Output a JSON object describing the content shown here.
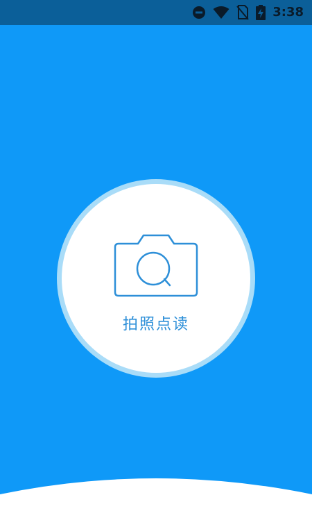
{
  "status_bar": {
    "time": "3:38",
    "icons": [
      "do-not-disturb-icon",
      "wifi-icon",
      "no-sim-icon",
      "battery-charging-icon"
    ]
  },
  "main": {
    "button_label": "拍照点读",
    "button_icon": "camera-icon"
  },
  "colors": {
    "background": "#0f99f8",
    "status_bar": "#0b5f99",
    "ring": "#a9dcf8",
    "accent": "#2d8fd8",
    "white": "#ffffff"
  }
}
